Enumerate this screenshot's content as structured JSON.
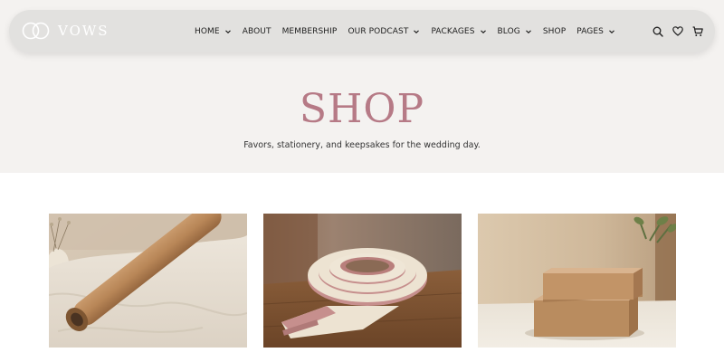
{
  "header": {
    "logo_text": "VOWS",
    "nav": [
      {
        "label": "HOME",
        "dropdown": true
      },
      {
        "label": "ABOUT",
        "dropdown": false
      },
      {
        "label": "MEMBERSHIP",
        "dropdown": false
      },
      {
        "label": "OUR PODCAST",
        "dropdown": true
      },
      {
        "label": "PACKAGES",
        "dropdown": true
      },
      {
        "label": "BLOG",
        "dropdown": true
      },
      {
        "label": "SHOP",
        "dropdown": false
      },
      {
        "label": "PAGES",
        "dropdown": true
      }
    ],
    "icons": [
      "search-icon",
      "heart-icon",
      "cart-icon"
    ]
  },
  "hero": {
    "title": "SHOP",
    "subtitle": "Favors, stationery, and keepsakes for the wedding day."
  },
  "products": [
    {
      "image": "cork-yoga-mat"
    },
    {
      "image": "pink-cream-strap-roll"
    },
    {
      "image": "cork-blocks"
    }
  ],
  "colors": {
    "accent": "#b67a86",
    "hero_bg": "#f4f2f0",
    "header_bg": "#e2e1df"
  }
}
